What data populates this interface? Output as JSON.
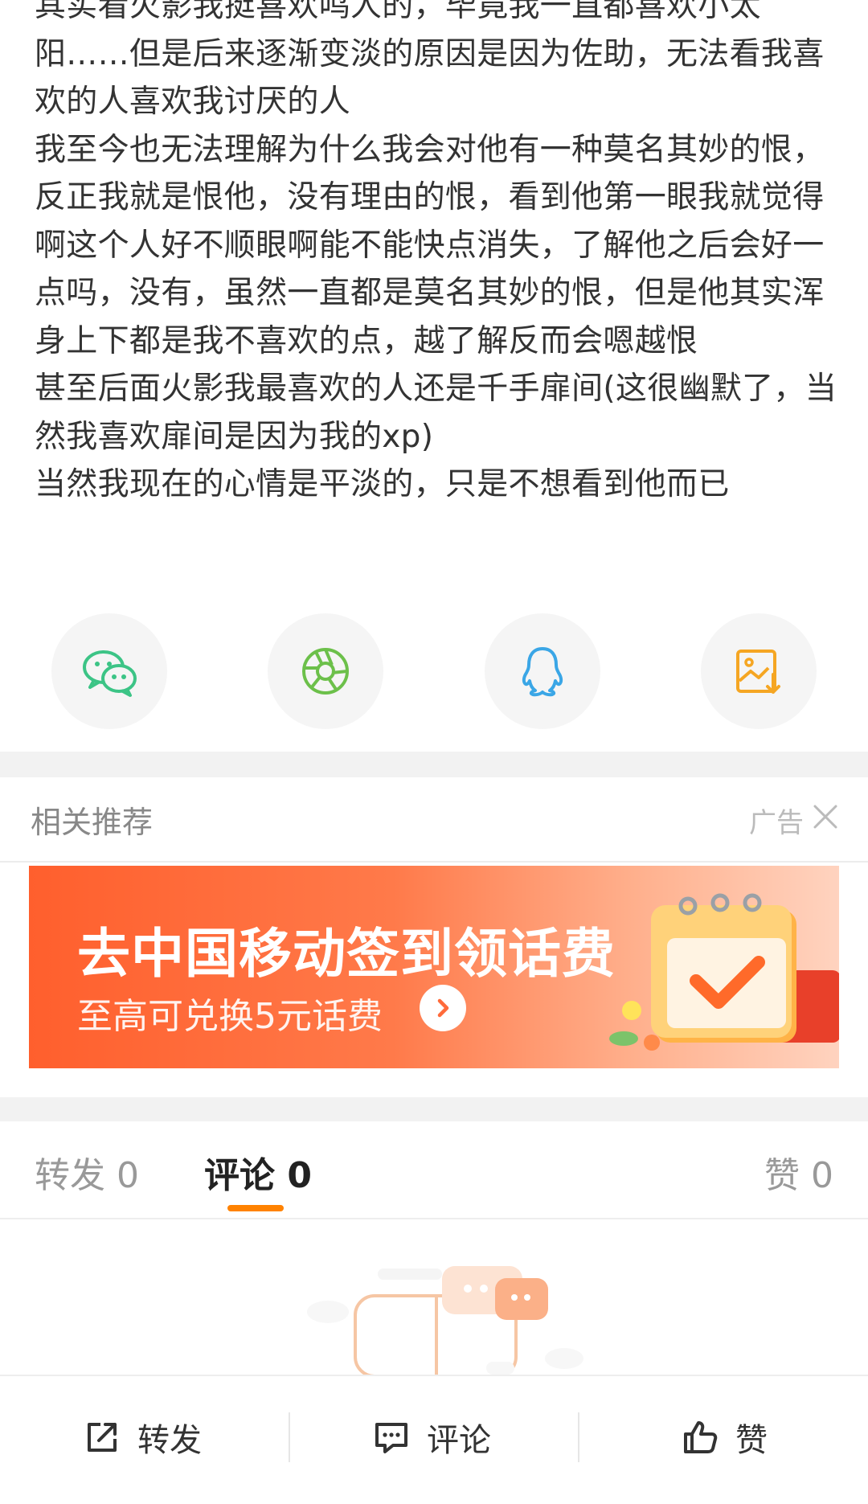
{
  "post": {
    "paragraphs": [
      "其实看火影我挺喜欢鸣人的，毕竟我一直都喜欢小太阳……但是后来逐渐变淡的原因是因为佐助，无法看我喜欢的人喜欢我讨厌的人",
      "我至今也无法理解为什么我会对他有一种莫名其妙的恨，反正我就是恨他，没有理由的恨，看到他第一眼我就觉得啊这个人好不顺眼啊能不能快点消失，了解他之后会好一点吗，没有，虽然一直都是莫名其妙的恨，但是他其实浑身上下都是我不喜欢的点，越了解反而会嗯越恨",
      "甚至后面火影我最喜欢的人还是千手扉间(这很幽默了，当然我喜欢扉间是因为我的xp)",
      "当然我现在的心情是平淡的，只是不想看到他而已"
    ]
  },
  "share": [
    {
      "icon": "wechat-icon",
      "color": "#3cc486"
    },
    {
      "icon": "moments-icon",
      "color": "#6cc04a"
    },
    {
      "icon": "qq-icon",
      "color": "#3aa6e6"
    },
    {
      "icon": "save-image-icon",
      "color": "#f5a623"
    }
  ],
  "related": {
    "title": "相关推荐",
    "ad_label": "广告"
  },
  "banner": {
    "title": "去中国移动签到领话费",
    "subtitle": "至高可兑换5元话费"
  },
  "tabs": {
    "repost": "转发 0",
    "comment": "评论 0",
    "like": "赞 0"
  },
  "bottom_bar": {
    "repost": "转发",
    "comment": "评论",
    "like": "赞"
  },
  "colors": {
    "accent": "#ff8200",
    "banner_start": "#ff5f2d",
    "banner_end": "#ffd3bf"
  }
}
